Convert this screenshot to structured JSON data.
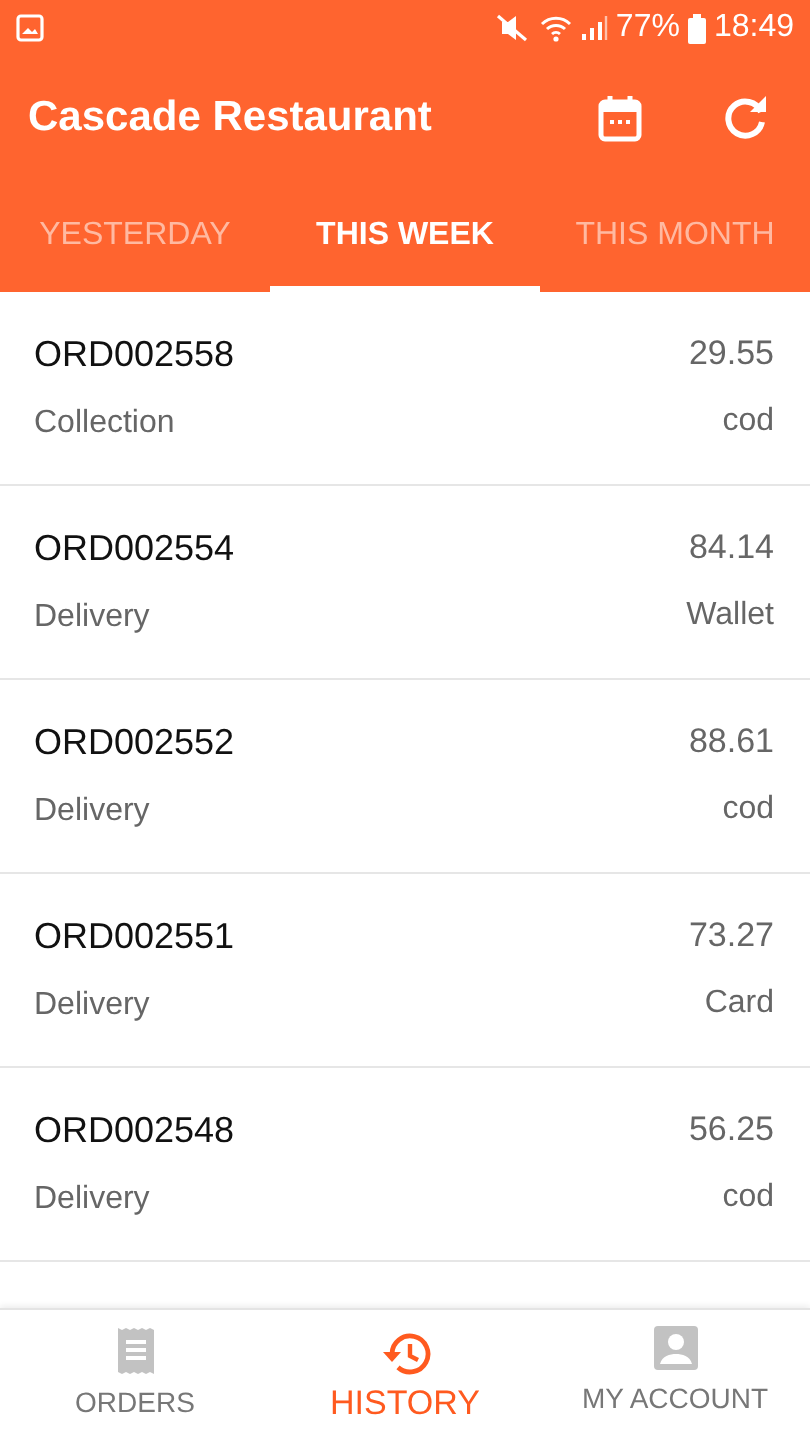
{
  "status_bar": {
    "battery": "77%",
    "time": "18:49"
  },
  "app_bar": {
    "title": "Cascade Restaurant"
  },
  "tabs": [
    {
      "label": "YESTERDAY",
      "selected": false
    },
    {
      "label": "THIS WEEK",
      "selected": true
    },
    {
      "label": "THIS MONTH",
      "selected": false
    }
  ],
  "orders": [
    {
      "id": "ORD002558",
      "type": "Collection",
      "amount": "29.55",
      "payment": "cod"
    },
    {
      "id": "ORD002554",
      "type": "Delivery",
      "amount": "84.14",
      "payment": "Wallet"
    },
    {
      "id": "ORD002552",
      "type": "Delivery",
      "amount": "88.61",
      "payment": "cod"
    },
    {
      "id": "ORD002551",
      "type": "Delivery",
      "amount": "73.27",
      "payment": "Card"
    },
    {
      "id": "ORD002548",
      "type": "Delivery",
      "amount": "56.25",
      "payment": "cod"
    }
  ],
  "bottom_nav": [
    {
      "label": "ORDERS",
      "kind": "orders",
      "selected": false
    },
    {
      "label": "HISTORY",
      "kind": "history",
      "selected": true
    },
    {
      "label": "MY ACCOUNT",
      "kind": "account",
      "selected": false
    }
  ]
}
